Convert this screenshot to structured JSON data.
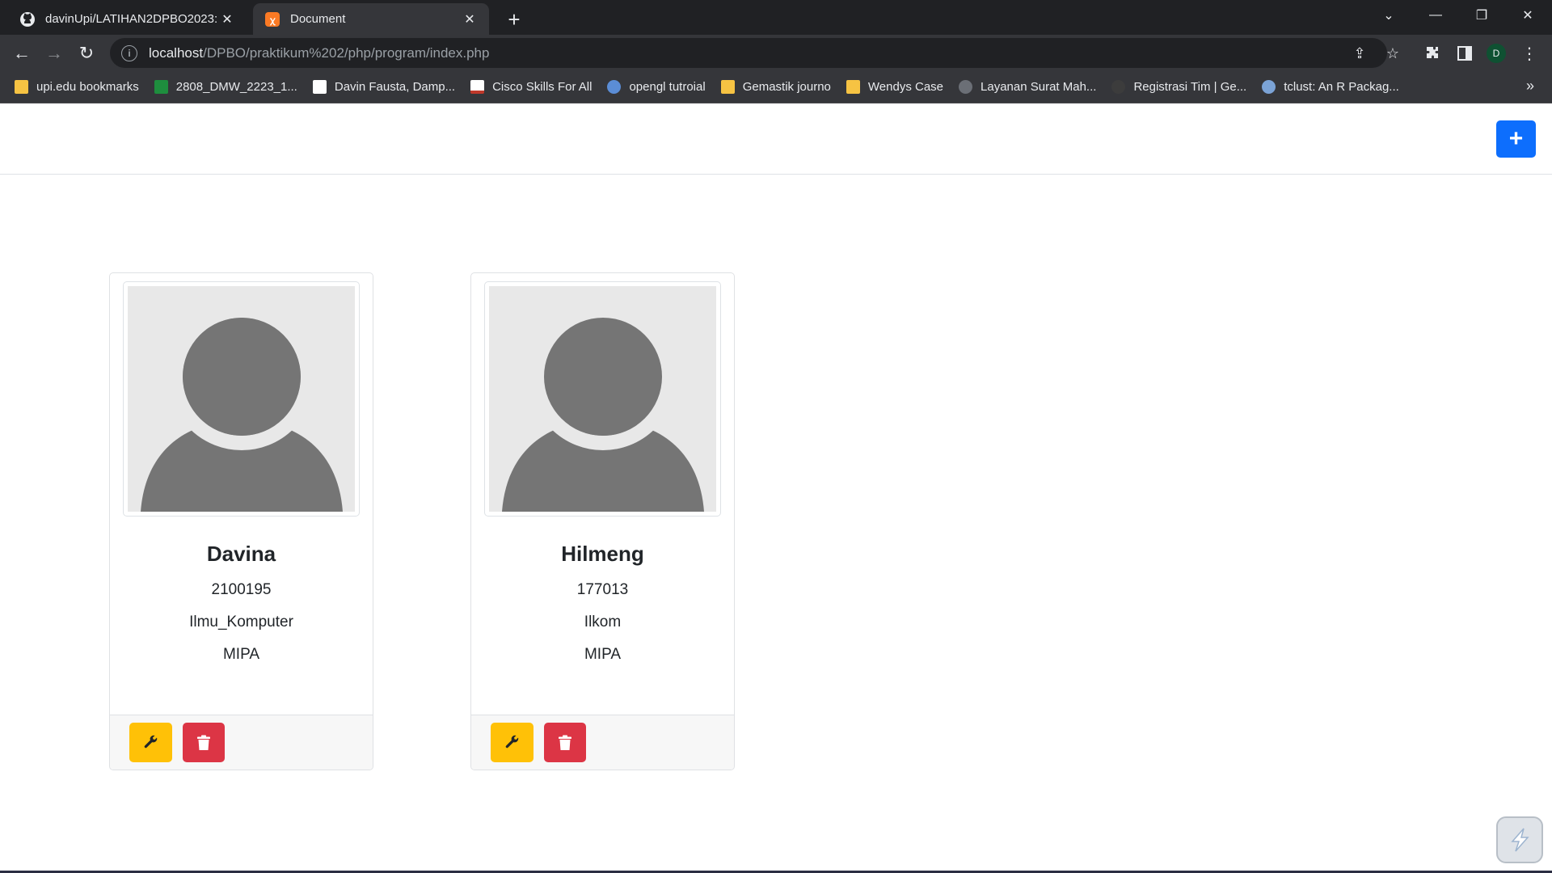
{
  "browser": {
    "tabs": [
      {
        "title": "davinUpi/LATIHAN2DPBO2023: ",
        "favicon": "github-icon",
        "active": false
      },
      {
        "title": "Document",
        "favicon": "xampp-icon",
        "active": true
      }
    ],
    "address": {
      "host": "localhost",
      "path": "/DPBO/praktikum%202/php/program/index.php"
    },
    "profile_initial": "D",
    "bookmarks": [
      {
        "label": "upi.edu bookmarks",
        "icon": "folder-icon",
        "color": "#f6c343"
      },
      {
        "label": "2808_DMW_2223_1...",
        "icon": "sheets-icon",
        "color": "#1e8e3e"
      },
      {
        "label": "Davin Fausta, Damp...",
        "icon": "pkp-icon",
        "color": "#ffffff"
      },
      {
        "label": "Cisco Skills For All",
        "icon": "cisco-icon",
        "color": "#ffffff"
      },
      {
        "label": "opengl tutroial",
        "icon": "opengl-icon",
        "color": "#5b8dd6"
      },
      {
        "label": "Gemastik journo",
        "icon": "folder-icon",
        "color": "#f6c343"
      },
      {
        "label": "Wendys Case",
        "icon": "folder-icon",
        "color": "#f6c343"
      },
      {
        "label": "Layanan Surat Mah...",
        "icon": "site-icon",
        "color": "#6b6f76"
      },
      {
        "label": "Registrasi Tim | Ge...",
        "icon": "site-icon",
        "color": "#3c3c3c"
      },
      {
        "label": "tclust: An R Packag...",
        "icon": "r-icon",
        "color": "#7ba3d6"
      }
    ]
  },
  "page": {
    "add_label": "+",
    "cards": [
      {
        "name": "Davina",
        "nim": "2100195",
        "prodi": "Ilmu_Komputer",
        "fakultas": "MIPA"
      },
      {
        "name": "Hilmeng",
        "nim": "177013",
        "prodi": "Ilkom",
        "fakultas": "MIPA"
      }
    ]
  },
  "colors": {
    "primary": "#0d6efd",
    "warning": "#ffc107",
    "danger": "#dc3545"
  }
}
